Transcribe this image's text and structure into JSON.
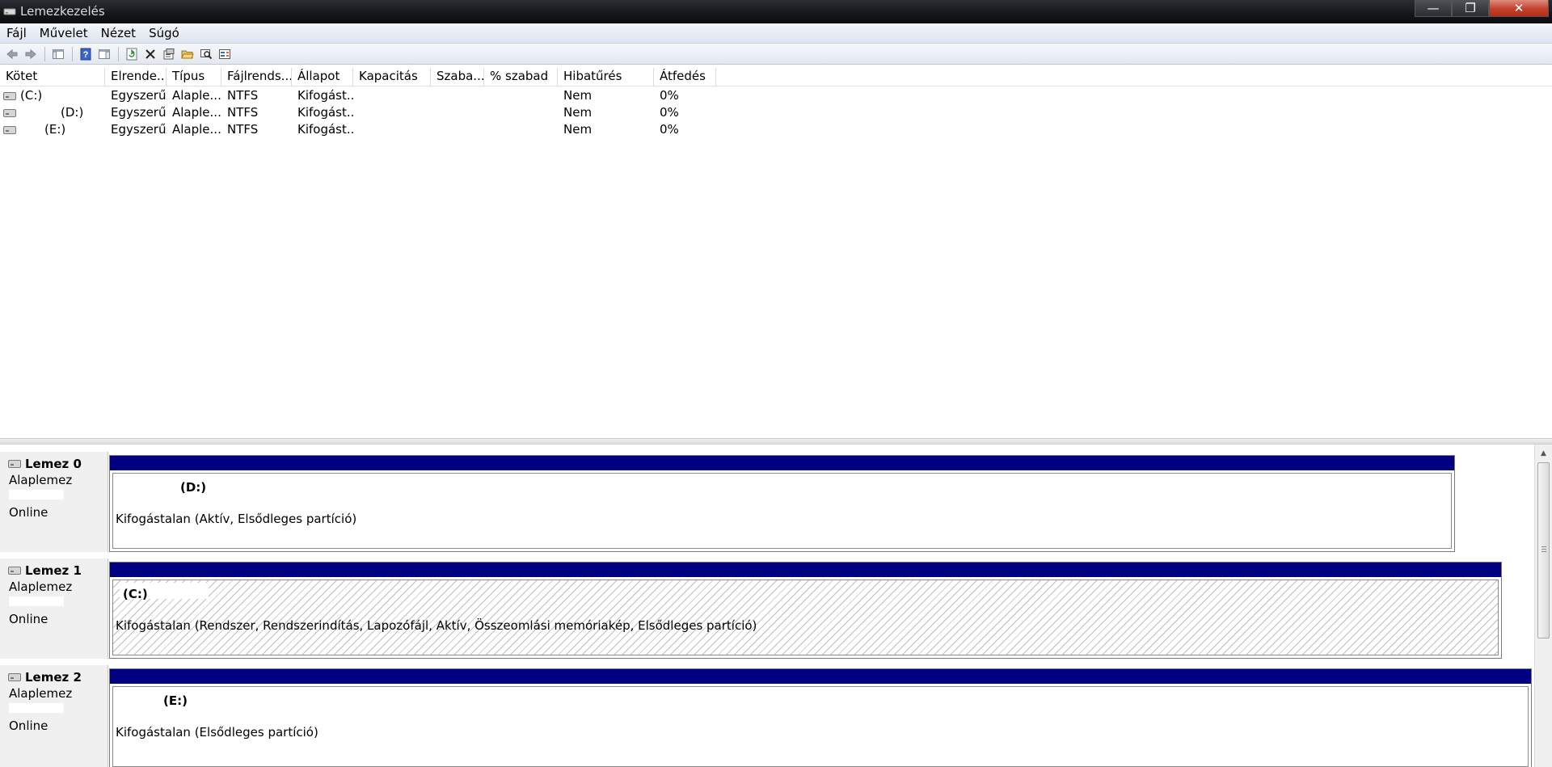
{
  "window": {
    "title": "Lemezkezelés",
    "minimize": "—",
    "maximize": "❐",
    "close": "✕"
  },
  "menu": [
    "Fájl",
    "Művelet",
    "Nézet",
    "Súgó"
  ],
  "toolbar": [
    "back-icon",
    "forward-icon",
    "console-tree-icon",
    "help-icon",
    "properties-pane-icon",
    "refresh-icon",
    "delete-icon",
    "properties-icon",
    "open-icon",
    "explore-icon",
    "settings-icon"
  ],
  "volume_table": {
    "columns": [
      "Kötet",
      "Elrende...",
      "Típus",
      "Fájlrends...",
      "Állapot",
      "Kapacitás",
      "Szaba...",
      "% szabad",
      "Hibatűrés",
      "Átfedés"
    ],
    "rows": [
      [
        "(C:)",
        "Egyszerű",
        "Alaple...",
        "NTFS",
        "Kifogást...",
        "",
        "",
        "",
        "Nem",
        "0%"
      ],
      [
        "(D:)",
        "Egyszerű",
        "Alaple...",
        "NTFS",
        "Kifogást...",
        "",
        "",
        "",
        "Nem",
        "0%"
      ],
      [
        "(E:)",
        "Egyszerű",
        "Alaple...",
        "NTFS",
        "Kifogást...",
        "",
        "",
        "",
        "Nem",
        "0%"
      ]
    ]
  },
  "disks": [
    {
      "name": "Lemez 0",
      "type": "Alaplemez",
      "status": "Online",
      "partition": {
        "label": "(D:)",
        "status": "Kifogástalan (Aktív, Elsődleges partíció)"
      }
    },
    {
      "name": "Lemez 1",
      "type": "Alaplemez",
      "status": "Online",
      "partition": {
        "label": "(C:)",
        "status": "Kifogástalan (Rendszer, Rendszerindítás, Lapozófájl, Aktív, Összeomlási memóriakép, Elsődleges partíció)"
      }
    },
    {
      "name": "Lemez 2",
      "type": "Alaplemez",
      "status": "Online",
      "partition": {
        "label": "(E:)",
        "status": "Kifogástalan (Elsődleges partíció)"
      }
    }
  ],
  "colors": {
    "partition_bar": "#000080",
    "menu_bg": "#dde4ee",
    "disk_label_bg": "#f0f0f0"
  }
}
